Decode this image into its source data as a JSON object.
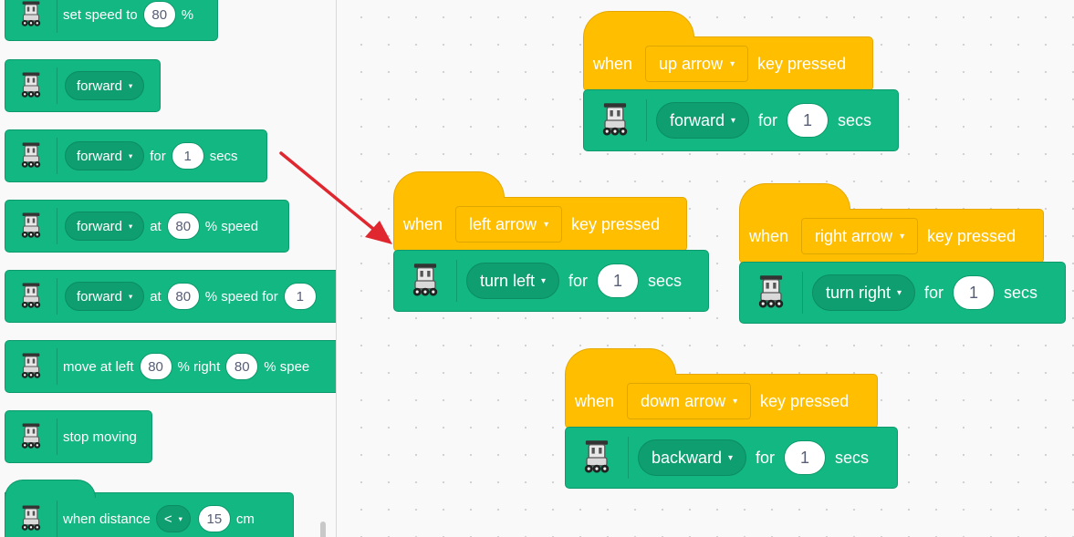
{
  "palette": {
    "set_speed": {
      "label": "set speed to",
      "value": "80",
      "unit": "%"
    },
    "forward": {
      "direction": "forward"
    },
    "forward_for": {
      "direction": "forward",
      "for_label": "for",
      "value": "1",
      "unit": "secs"
    },
    "forward_at": {
      "direction": "forward",
      "at_label": "at",
      "value": "80",
      "unit": "% speed"
    },
    "forward_at_for": {
      "direction": "forward",
      "at_label": "at",
      "value": "80",
      "unit": "% speed for",
      "secs_value": "1"
    },
    "move_at": {
      "label": "move at left",
      "left_value": "80",
      "right_label": "% right",
      "right_value": "80",
      "unit": "% spee"
    },
    "stop": {
      "label": "stop moving"
    },
    "when_distance": {
      "label": "when distance",
      "operator": "<",
      "value": "15",
      "unit": "cm"
    }
  },
  "workspace": {
    "scripts": [
      {
        "when": "when",
        "key": "up arrow",
        "pressed": "key pressed",
        "direction": "forward",
        "for_label": "for",
        "value": "1",
        "unit": "secs"
      },
      {
        "when": "when",
        "key": "left arrow",
        "pressed": "key pressed",
        "direction": "turn left",
        "for_label": "for",
        "value": "1",
        "unit": "secs"
      },
      {
        "when": "when",
        "key": "right arrow",
        "pressed": "key pressed",
        "direction": "turn right",
        "for_label": "for",
        "value": "1",
        "unit": "secs"
      },
      {
        "when": "when",
        "key": "down arrow",
        "pressed": "key pressed",
        "direction": "backward",
        "for_label": "for",
        "value": "1",
        "unit": "secs"
      }
    ]
  },
  "icons": {
    "caret": "▾"
  },
  "colors": {
    "motion_block": "#13b781",
    "event_hat": "#ffbf00",
    "arrow": "#e0262e"
  }
}
